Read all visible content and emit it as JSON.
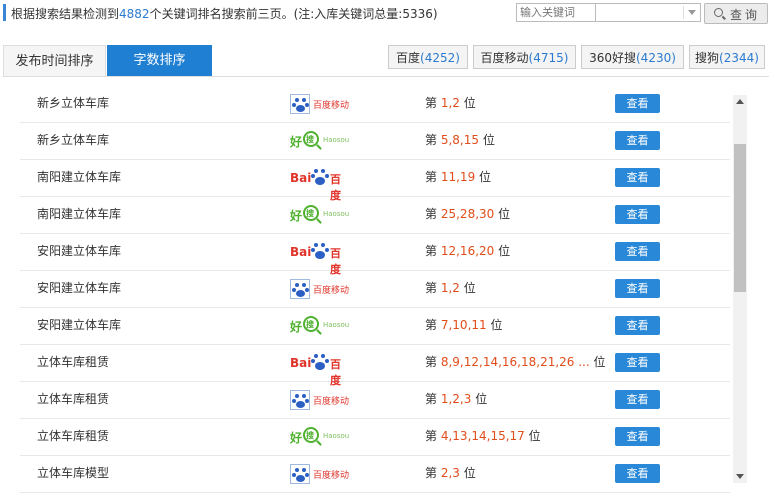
{
  "summary": {
    "prefix": "根据搜索结果检测到",
    "count": "4882",
    "suffix": "个关键词排名搜索前三页。(注:入库关键词总量:5336)"
  },
  "search": {
    "placeholder": "输入关键词",
    "select_value": "",
    "query_label": "查询"
  },
  "tabs": [
    {
      "label": "发布时间排序",
      "active": false
    },
    {
      "label": "字数排序",
      "active": true
    }
  ],
  "engines": [
    {
      "label": "百度",
      "count": "(4252)"
    },
    {
      "label": "百度移动",
      "count": "(4715)"
    },
    {
      "label": "360好搜",
      "count": "(4230)"
    },
    {
      "label": "搜狗",
      "count": "(2344)"
    }
  ],
  "rank_prefix": "第",
  "rank_suffix": "位",
  "view_label": "查看",
  "logo_text": {
    "baidu_mobile": "百度移动",
    "haosou_cn": "好",
    "haosou_sou": "搜",
    "haosou_en": "Haosou",
    "baidu_bai": "Bai",
    "baidu_du": "百度"
  },
  "rows": [
    {
      "keyword": "新乡立体车库",
      "engine": "baidu-mobile",
      "positions": "1,2"
    },
    {
      "keyword": "新乡立体车库",
      "engine": "haosou",
      "positions": "5,8,15"
    },
    {
      "keyword": "南阳建立体车库",
      "engine": "baidu",
      "positions": "11,19"
    },
    {
      "keyword": "南阳建立体车库",
      "engine": "haosou",
      "positions": "25,28,30"
    },
    {
      "keyword": "安阳建立体车库",
      "engine": "baidu",
      "positions": "12,16,20"
    },
    {
      "keyword": "安阳建立体车库",
      "engine": "baidu-mobile",
      "positions": "1,2"
    },
    {
      "keyword": "安阳建立体车库",
      "engine": "haosou",
      "positions": "7,10,11"
    },
    {
      "keyword": "立体车库租赁",
      "engine": "baidu",
      "positions": "8,9,12,14,16,18,21,26 ..."
    },
    {
      "keyword": "立体车库租赁",
      "engine": "baidu-mobile",
      "positions": "1,2,3"
    },
    {
      "keyword": "立体车库租赁",
      "engine": "haosou",
      "positions": "4,13,14,15,17"
    },
    {
      "keyword": "立体车库模型",
      "engine": "baidu-mobile",
      "positions": "2,3"
    }
  ]
}
